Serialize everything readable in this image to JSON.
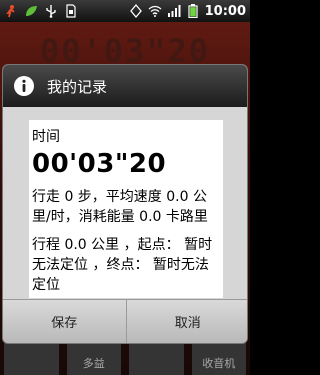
{
  "status_bar": {
    "time": "10:00",
    "icons": [
      "running-app-icon",
      "leaf-icon",
      "usb-icon",
      "sim-icon",
      "vibration-icon",
      "wifi-icon",
      "signal-icon",
      "battery-icon"
    ]
  },
  "background": {
    "title": "00'03\"20",
    "tiles": [
      "",
      "多益",
      "",
      "收音机"
    ]
  },
  "dialog": {
    "title": "我的记录",
    "label_time": "时间",
    "time_value": "00'03\"20",
    "para1": "行走 0 步，平均速度 0.0 公里/时，消耗能量 0.0 卡路里",
    "para2": "行程 0.0 公里 ，起点： 暂时无法定位 ，终点： 暂时无法定位",
    "save_label": "保存",
    "cancel_label": "取消"
  },
  "colors": {
    "dialog_bg": "#d6d6d6",
    "header_bg": "#1c1c1c",
    "accent": "#4fa3ff"
  }
}
